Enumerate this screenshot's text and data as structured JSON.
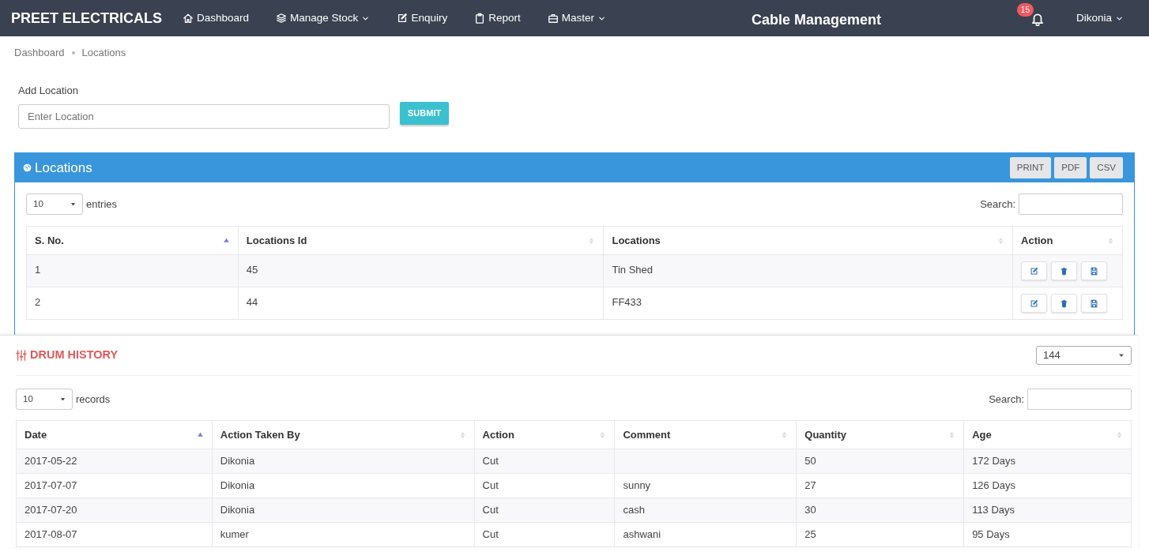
{
  "brand": "PREET ELECTRICALS",
  "nav": [
    {
      "label": "Dashboard",
      "dropdown": false
    },
    {
      "label": "Manage Stock",
      "dropdown": true
    },
    {
      "label": "Enquiry",
      "dropdown": false
    },
    {
      "label": "Report",
      "dropdown": false
    },
    {
      "label": "Master",
      "dropdown": true
    }
  ],
  "app_title": "Cable Management",
  "notifications": {
    "count": "15"
  },
  "user": {
    "name": "Dikonia",
    "dropdown": true
  },
  "breadcrumb": [
    "Dashboard",
    "Locations"
  ],
  "add_location": {
    "label": "Add Location",
    "placeholder": "Enter Location",
    "button": "SUBMIT"
  },
  "locations": {
    "title": "Locations",
    "exports": [
      "PRINT",
      "PDF",
      "CSV"
    ],
    "length": "10",
    "length_label": "entries",
    "search_label": "Search:",
    "columns": [
      {
        "label": "S. No.",
        "sorted": true
      },
      {
        "label": "Locations Id",
        "sorted": false
      },
      {
        "label": "Locations",
        "sorted": false
      },
      {
        "label": "Action",
        "sorted": false
      }
    ],
    "rows": [
      [
        "1",
        "45",
        "Tin Shed"
      ],
      [
        "2",
        "44",
        "FF433"
      ]
    ]
  },
  "drum_history": {
    "title": "DRUM HISTORY",
    "drum": "144",
    "length": "10",
    "length_label": "records",
    "search_label": "Search:",
    "columns": [
      {
        "label": "Date",
        "sorted": true
      },
      {
        "label": "Action Taken By",
        "sorted": false
      },
      {
        "label": "Action",
        "sorted": false
      },
      {
        "label": "Comment",
        "sorted": false
      },
      {
        "label": "Quantity",
        "sorted": false
      },
      {
        "label": "Age",
        "sorted": false
      }
    ],
    "rows": [
      [
        "2017-05-22",
        "Dikonia",
        "Cut",
        null,
        "50",
        "172 Days"
      ],
      [
        "2017-07-07",
        "Dikonia",
        "Cut",
        "sunny",
        "27",
        "126 Days"
      ],
      [
        "2017-07-20",
        "Dikonia",
        "Cut",
        "cash",
        "30",
        "113 Days"
      ],
      [
        "2017-08-07",
        "kumer",
        "Cut",
        "ashwani",
        "25",
        "95 Days"
      ]
    ]
  }
}
